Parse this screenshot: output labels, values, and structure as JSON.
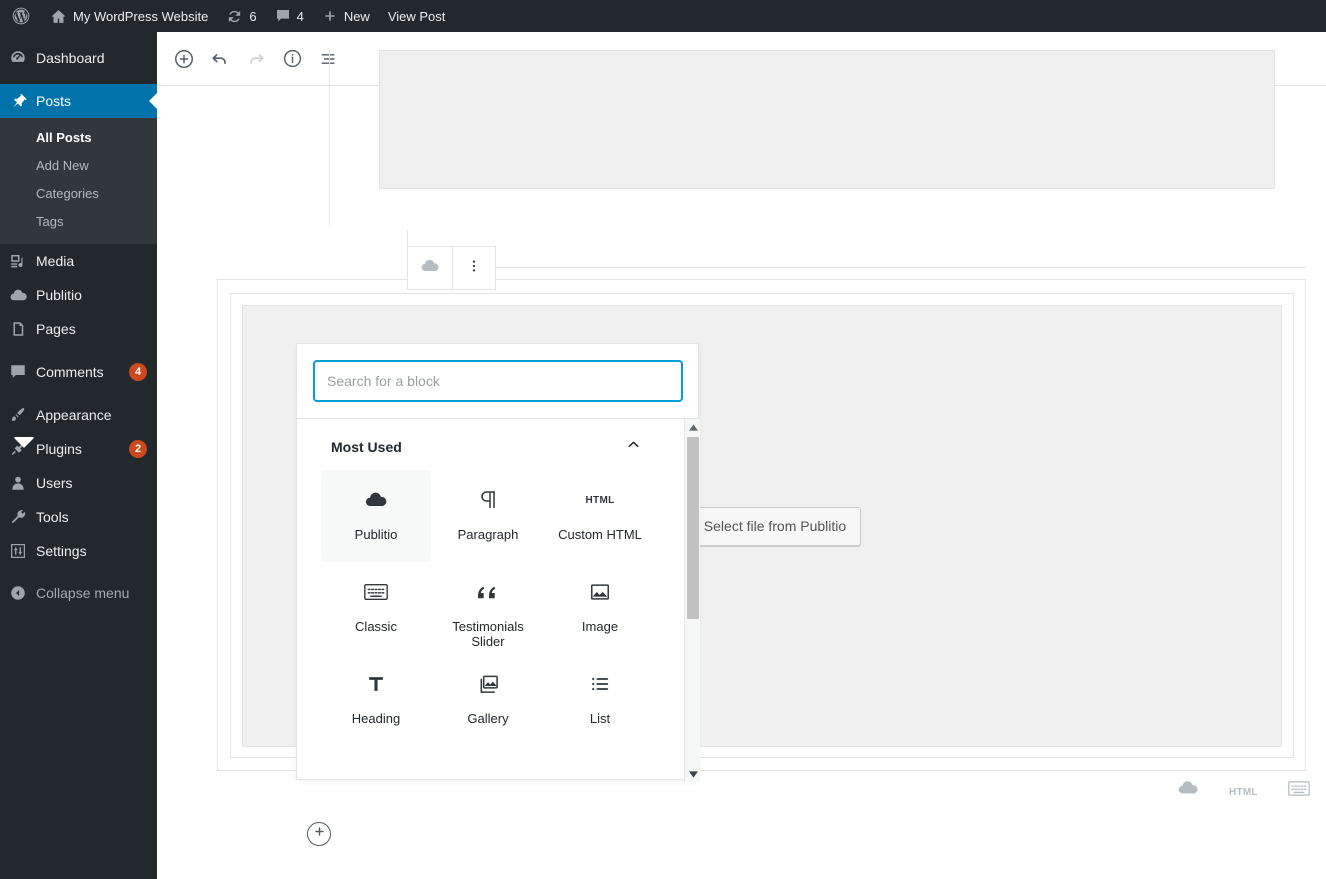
{
  "adminbar": {
    "logo_icon": "wordpress-logo-icon",
    "home_icon": "home-icon",
    "site_title": "My WordPress Website",
    "updates_icon": "updates-icon",
    "updates_count": "6",
    "comments_icon": "comment-bubble-icon",
    "comments_count": "4",
    "new_icon": "plus-icon",
    "new_label": "New",
    "view_post_label": "View Post"
  },
  "sidebar": {
    "items": [
      {
        "label": "Dashboard",
        "icon": "dashboard-icon",
        "current": false
      },
      {
        "label": "Posts",
        "icon": "pin-icon",
        "current": true
      },
      {
        "label": "Media",
        "icon": "media-icon",
        "current": false
      },
      {
        "label": "Publitio",
        "icon": "cloud-icon",
        "current": false
      },
      {
        "label": "Pages",
        "icon": "pages-icon",
        "current": false
      },
      {
        "label": "Comments",
        "icon": "comment-bubble-icon",
        "current": false,
        "badge": "4"
      },
      {
        "label": "Appearance",
        "icon": "paintbrush-icon",
        "current": false
      },
      {
        "label": "Plugins",
        "icon": "plug-icon",
        "current": false,
        "badge": "2"
      },
      {
        "label": "Users",
        "icon": "user-icon",
        "current": false
      },
      {
        "label": "Tools",
        "icon": "wrench-icon",
        "current": false
      },
      {
        "label": "Settings",
        "icon": "settings-sliders-icon",
        "current": false
      }
    ],
    "submenu": [
      {
        "label": "All Posts",
        "current": true
      },
      {
        "label": "Add New",
        "current": false
      },
      {
        "label": "Categories",
        "current": false
      },
      {
        "label": "Tags",
        "current": false
      }
    ],
    "collapse_label": "Collapse menu",
    "collapse_icon": "collapse-arrow-icon",
    "accent_color": "#0073aa",
    "background_color": "#23282d",
    "submenu_background": "#32373c",
    "badge_color": "#ca4a1f"
  },
  "editor": {
    "toolbar": [
      {
        "name": "add-block-button",
        "icon": "plus-circle-icon",
        "disabled": false
      },
      {
        "name": "undo-button",
        "icon": "undo-arrow-icon",
        "disabled": false
      },
      {
        "name": "redo-button",
        "icon": "redo-arrow-icon",
        "disabled": true
      },
      {
        "name": "content-info-button",
        "icon": "info-circle-icon",
        "disabled": false
      },
      {
        "name": "block-navigation-button",
        "icon": "list-view-icon",
        "disabled": false
      }
    ],
    "block_toolbar": {
      "block_type_icon": "cloud-icon",
      "more_options_icon": "vertical-dots-icon"
    },
    "publitio_block": {
      "select_button_label": "Select file from Publitio",
      "select_button_icon": "cloud-icon"
    },
    "bottom_icons": [
      {
        "name": "publitio-quick-insert",
        "icon": "cloud-icon",
        "label": ""
      },
      {
        "name": "custom-html-quick-insert",
        "icon": "html-icon",
        "label": "HTML"
      },
      {
        "name": "classic-quick-insert",
        "icon": "keyboard-icon",
        "label": ""
      }
    ],
    "bottom_add_button_icon": "plus-circle-icon"
  },
  "inserter": {
    "search": {
      "placeholder": "Search for a block",
      "value": "",
      "focus_color": "#00a0d2"
    },
    "panel": {
      "title": "Most Used",
      "collapse_icon": "chevron-up-icon"
    },
    "blocks": [
      {
        "label": "Publitio",
        "icon": "cloud-icon",
        "active": true
      },
      {
        "label": "Paragraph",
        "icon": "pilcrow-icon",
        "active": false
      },
      {
        "label": "Custom HTML",
        "icon": "html-icon",
        "active": false
      },
      {
        "label": "Classic",
        "icon": "keyboard-icon",
        "active": false
      },
      {
        "label": "Testimonials Slider",
        "icon": "quote-icon",
        "active": false
      },
      {
        "label": "Image",
        "icon": "image-icon",
        "active": false
      },
      {
        "label": "Heading",
        "icon": "heading-t-icon",
        "active": false
      },
      {
        "label": "Gallery",
        "icon": "gallery-icon",
        "active": false
      },
      {
        "label": "List",
        "icon": "list-icon",
        "active": false
      }
    ],
    "scrollbar": {
      "up_icon": "scroll-up-arrow-icon",
      "down_icon": "scroll-down-arrow-icon"
    }
  }
}
